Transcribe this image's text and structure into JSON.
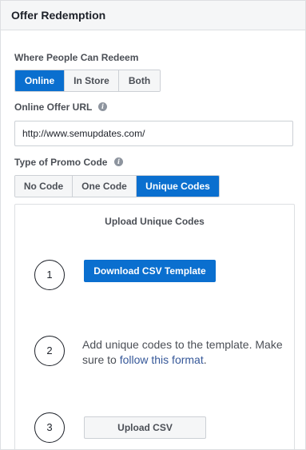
{
  "panel": {
    "title": "Offer Redemption"
  },
  "redeem": {
    "label": "Where People Can Redeem",
    "options": [
      "Online",
      "In Store",
      "Both"
    ],
    "selected": "Online"
  },
  "url": {
    "label": "Online Offer URL",
    "value": "http://www.semupdates.com/"
  },
  "promo": {
    "label": "Type of Promo Code",
    "options": [
      "No Code",
      "One Code",
      "Unique Codes"
    ],
    "selected": "Unique Codes"
  },
  "upload": {
    "title": "Upload Unique Codes",
    "steps": [
      {
        "number": "1",
        "button": "Download CSV Template"
      },
      {
        "number": "2",
        "text_before": "Add unique codes to the template. Make sure to ",
        "link": "follow this format",
        "text_after": "."
      },
      {
        "number": "3",
        "button": "Upload CSV"
      }
    ]
  },
  "icons": {
    "info": "info-icon"
  },
  "colors": {
    "accent": "#0a6fcf",
    "link": "#365899",
    "header_bg": "#f5f6f7"
  }
}
